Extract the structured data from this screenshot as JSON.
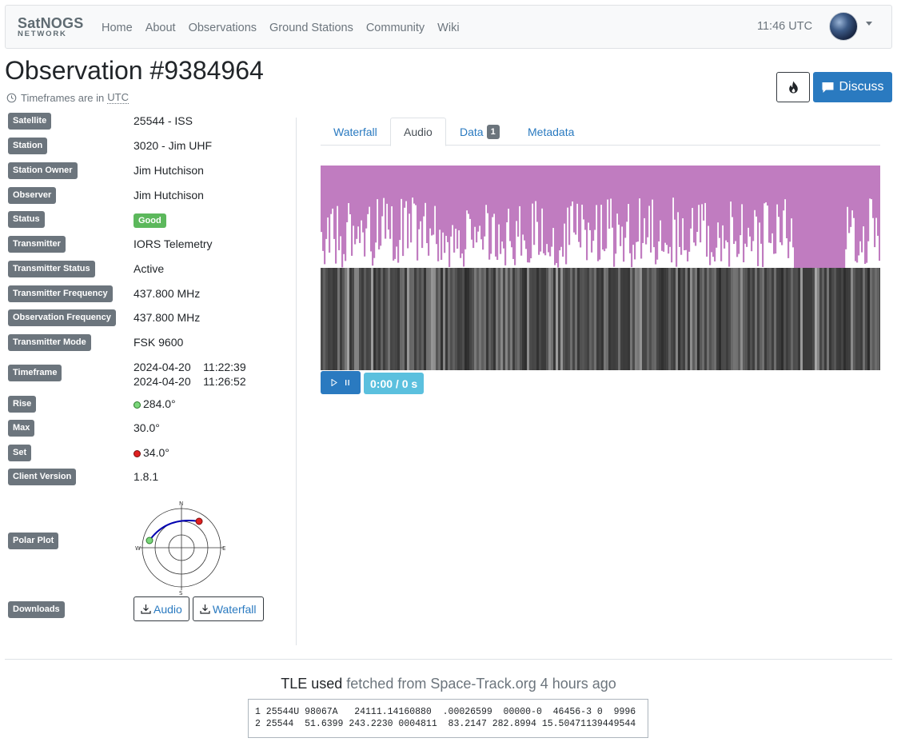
{
  "nav": {
    "brand_top": "SatNOGS",
    "brand_bottom": "NETWORK",
    "links": [
      "Home",
      "About",
      "Observations",
      "Ground Stations",
      "Community",
      "Wiki"
    ],
    "time": "11:46 UTC"
  },
  "header": {
    "title": "Observation #9384964",
    "tz_prefix": "Timeframes are in",
    "tz": "UTC",
    "discuss_label": "Discuss"
  },
  "details": {
    "satellite": {
      "label": "Satellite",
      "value": "25544 - ISS"
    },
    "station": {
      "label": "Station",
      "value": "3020 - Jim UHF"
    },
    "station_owner": {
      "label": "Station Owner",
      "value": "Jim Hutchison"
    },
    "observer": {
      "label": "Observer",
      "value": "Jim Hutchison"
    },
    "status": {
      "label": "Status",
      "value": "Good"
    },
    "transmitter": {
      "label": "Transmitter",
      "value": "IORS Telemetry"
    },
    "transmitter_status": {
      "label": "Transmitter Status",
      "value": "Active"
    },
    "transmitter_frequency": {
      "label": "Transmitter Frequency",
      "value": "437.800 MHz"
    },
    "observation_frequency": {
      "label": "Observation Frequency",
      "value": "437.800 MHz"
    },
    "transmitter_mode": {
      "label": "Transmitter Mode",
      "value": "FSK 9600"
    },
    "timeframe": {
      "label": "Timeframe",
      "start": "2024-04-20    11:22:39",
      "end": "2024-04-20    11:26:52"
    },
    "rise": {
      "label": "Rise",
      "value": "284.0°"
    },
    "max": {
      "label": "Max",
      "value": "30.0°"
    },
    "set": {
      "label": "Set",
      "value": "34.0°"
    },
    "client_version": {
      "label": "Client Version",
      "value": "1.8.1"
    },
    "polar_plot": {
      "label": "Polar Plot",
      "n": "N",
      "s": "S",
      "e": "E",
      "w": "W"
    },
    "downloads": {
      "label": "Downloads",
      "audio": "Audio",
      "waterfall": "Waterfall"
    }
  },
  "tabs": [
    {
      "label": "Waterfall"
    },
    {
      "label": "Audio",
      "active": true
    },
    {
      "label": "Data",
      "count": "1"
    },
    {
      "label": "Metadata"
    }
  ],
  "player": {
    "time": "0:00 / 0 s"
  },
  "tle": {
    "title": "TLE used",
    "subtitle": "fetched from Space-Track.org 4 hours ago",
    "line1": "1 25544U 98067A   24111.14160880  .00026599  00000-0  46456-3 0  9996",
    "line2": "2 25544  51.6399 243.2230 0004811  83.2147 282.8994 15.50471139449544"
  },
  "colors": {
    "accent": "#2a7ac0",
    "good": "#5cb85c",
    "waveform": "#c07cc0",
    "label_bg": "#6c757d",
    "info": "#5bc0de"
  }
}
